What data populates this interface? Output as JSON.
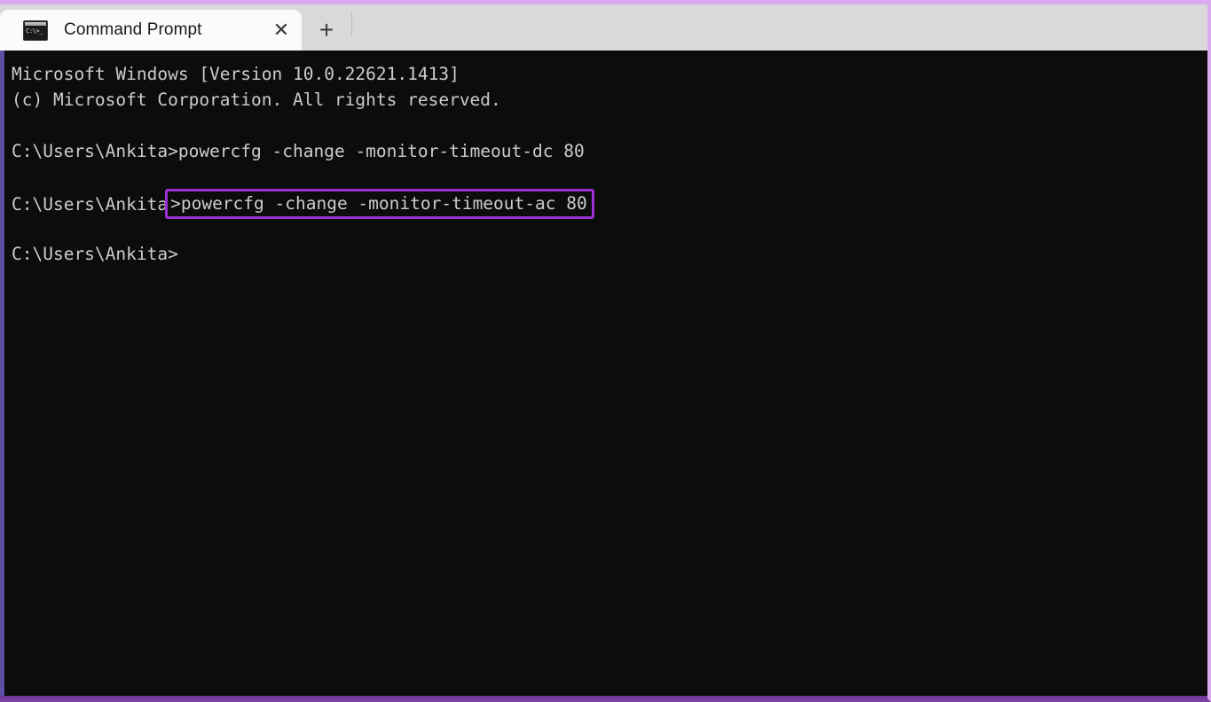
{
  "window": {
    "accent_top_color": "#dba9ef",
    "accent_bottom_color": "#7a3fa0",
    "left_accent_color": "#5a4fa3"
  },
  "title_bar": {
    "background_color": "#d9d9d9",
    "tab": {
      "label": "Command Prompt",
      "icon": "command-prompt-icon",
      "icon_glyph": "C:\\>_",
      "close_glyph": "✕"
    },
    "new_tab_glyph": "+",
    "dropdown_glyph": "ⱟ"
  },
  "terminal": {
    "background_color": "#0c0c0c",
    "text_color": "#cccccc",
    "highlight_color": "#9c2fd6",
    "lines": [
      {
        "type": "text",
        "text": "Microsoft Windows [Version 10.0.22621.1413]"
      },
      {
        "type": "text",
        "text": "(c) Microsoft Corporation. All rights reserved."
      },
      {
        "type": "blank",
        "text": ""
      },
      {
        "type": "prompt",
        "prompt": "C:\\Users\\Ankita>",
        "command": "powercfg -change -monitor-timeout-dc 80",
        "highlighted": false
      },
      {
        "type": "blank",
        "text": ""
      },
      {
        "type": "prompt",
        "prompt": "C:\\Users\\Ankita",
        "command": ">powercfg -change -monitor-timeout-ac 80",
        "highlighted": true
      },
      {
        "type": "blank",
        "text": ""
      },
      {
        "type": "prompt",
        "prompt": "C:\\Users\\Ankita>",
        "command": "",
        "highlighted": false
      }
    ]
  }
}
